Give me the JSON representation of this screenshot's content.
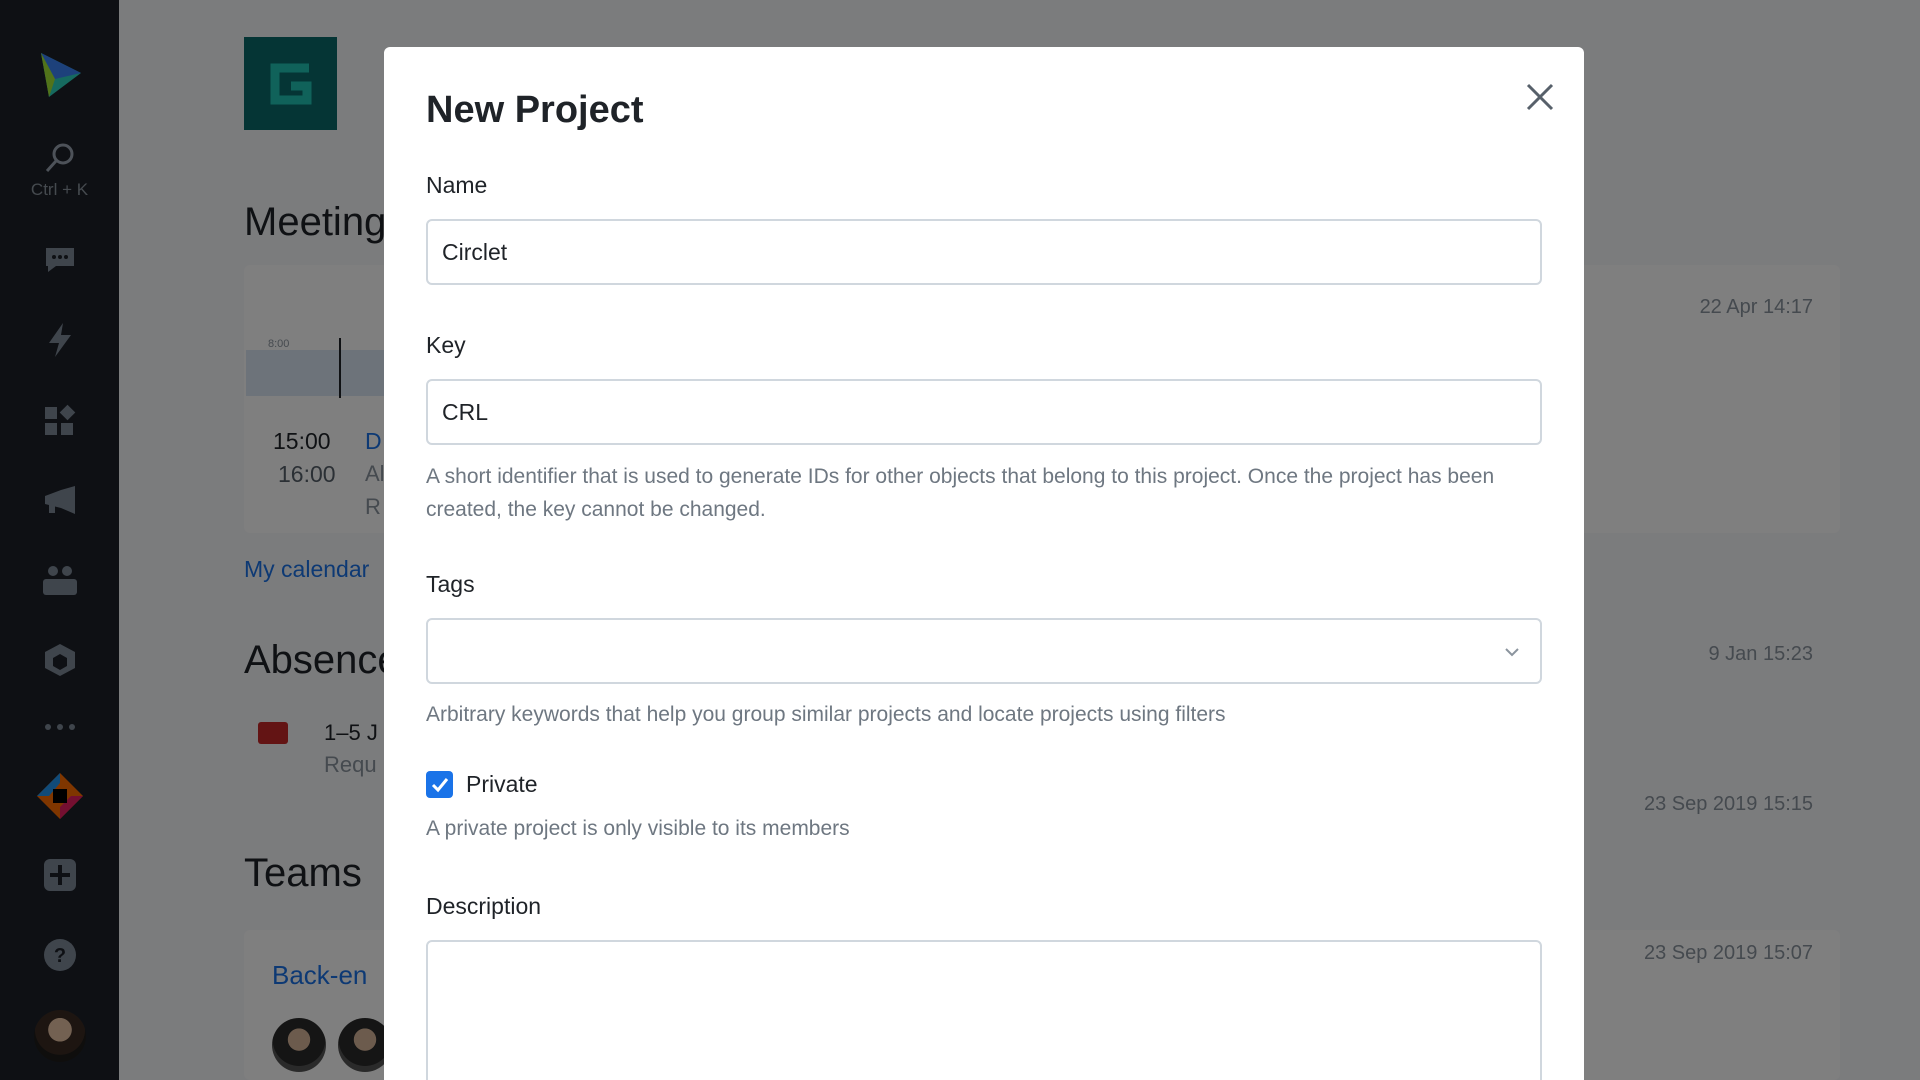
{
  "rail": {
    "search_hint": "Ctrl + K",
    "icons": [
      "logo-icon",
      "search-icon",
      "chat-icon",
      "bolt-icon",
      "apps-icon",
      "megaphone-icon",
      "team-icon",
      "package-icon",
      "more-icon",
      "jetbrains-icon",
      "add-icon",
      "help-icon",
      "avatar"
    ]
  },
  "background": {
    "meetings_title": "Meeting",
    "meeting_time_start": "15:00",
    "meeting_time_end": "16:00",
    "meeting_link_partial": "D",
    "meeting_detail_partial": "Al",
    "meeting_detail2_partial": "R",
    "timeline_label": "8:00",
    "my_calendar": "My calendar",
    "absences_title": "Absence",
    "absence_dates_partial": "1–5 J",
    "absence_status_partial": "Requ",
    "teams_title": "Teams",
    "team_name_partial": "Back-en",
    "dates": [
      "22 Apr 14:17",
      "9 Jan 15:23",
      "23 Sep 2019 15:15",
      "23 Sep 2019 15:07"
    ]
  },
  "dialog": {
    "title": "New Project",
    "name_label": "Name",
    "name_value": "Circlet",
    "key_label": "Key",
    "key_value": "CRL",
    "key_hint": "A short identifier that is used to generate IDs for other objects that belong to this project. Once the project has been created, the key cannot be changed.",
    "tags_label": "Tags",
    "tags_value": "",
    "tags_hint": "Arbitrary keywords that help you group similar projects and locate projects using filters",
    "private_label": "Private",
    "private_checked": true,
    "private_hint": "A private project is only visible to its members",
    "description_label": "Description",
    "description_value": ""
  },
  "colors": {
    "accent": "#1a73e8",
    "rail": "#1c2129",
    "overlay": "rgba(0,0,0,0.5)"
  }
}
